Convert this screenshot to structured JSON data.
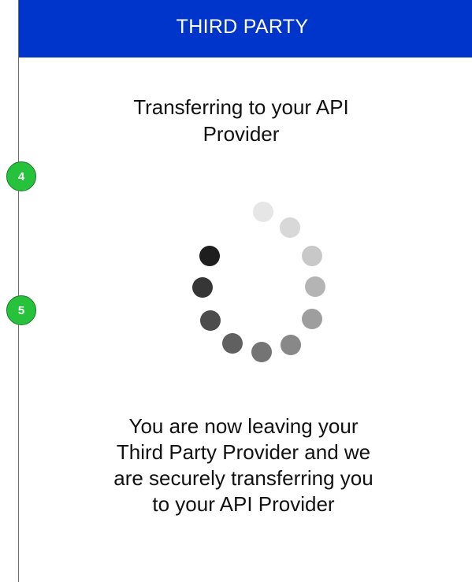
{
  "header": {
    "title": "THIRD PARTY",
    "background_color": "#0035cc"
  },
  "main": {
    "heading": "Transferring to your API Provider",
    "spinner": {
      "icon": "loading-spinner-icon",
      "dot_colors": [
        "#e6e6e6",
        "#d8d8d8",
        "#c8c8c8",
        "#b4b4b4",
        "#9e9e9e",
        "#888888",
        "#747474",
        "#606060",
        "#4c4c4c",
        "#363636",
        "#1e1e1e"
      ]
    },
    "message": "You are now leaving your Third Party Provider and we are securely transferring you to your API Provider"
  },
  "annotations": {
    "step_markers": [
      "4",
      "5"
    ],
    "marker_color": "#27c23c"
  }
}
